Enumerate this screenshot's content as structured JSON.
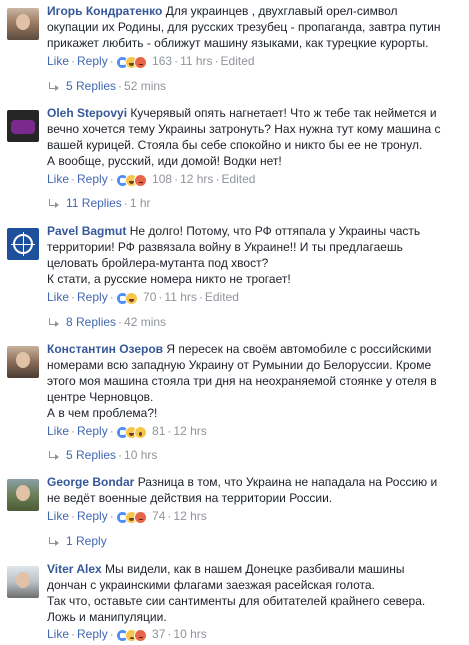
{
  "comments": [
    {
      "author": "Игорь Кондратенко",
      "text": "Для украинцев , двухглавый орел-символ\nокупации их Родины, для русских трезубец - пропаганда, завтра путин\nприкажет любить - оближут машину языками, как турецкие курорты.",
      "like_label": "Like",
      "reply_label": "Reply",
      "reactions": [
        "like",
        "haha",
        "angry"
      ],
      "reaction_count": "163",
      "time": "11 hrs",
      "edited": "Edited",
      "replies": "5 Replies",
      "replies_time": "52 mins"
    },
    {
      "author": "Oleh Stepovyi",
      "text": "Кучерявый опять нагнетает! Что ж тебе так неймется и\nвечно хочется тему Украины затронуть? Нах нужна тут кому машина с\nвашей курицей. Стояла бы себе спокойно и никто бы ее не тронул.\nА вообще, русский, иди домой! Водки нет!",
      "like_label": "Like",
      "reply_label": "Reply",
      "reactions": [
        "like",
        "haha",
        "angry"
      ],
      "reaction_count": "108",
      "time": "12 hrs",
      "edited": "Edited",
      "replies": "11 Replies",
      "replies_time": "1 hr"
    },
    {
      "author": "Pavel Bagmut",
      "text": "Не долго! Потому, что РФ оттяпала у Украины часть\nтерритории! РФ развязала войну в Украине!! И ты предлагаешь\nцеловать бройлера-мутанта под хвост?\nК стати, а русские номера никто не трогает!",
      "like_label": "Like",
      "reply_label": "Reply",
      "reactions": [
        "like",
        "haha"
      ],
      "reaction_count": "70",
      "time": "11 hrs",
      "edited": "Edited",
      "replies": "8 Replies",
      "replies_time": "42 mins"
    },
    {
      "author": "Константин Озеров",
      "text": "Я пересек на своём автомобиле с российскими\nномерами всю западную Украину от Румынии до Белоруссии. Кроме\nэтого моя машина стояла три дня на неохраняемой стоянке у отеля в\nцентре Черновцов.\nА в чем проблема?!",
      "like_label": "Like",
      "reply_label": "Reply",
      "reactions": [
        "like",
        "haha",
        "wow"
      ],
      "reaction_count": "81",
      "time": "12 hrs",
      "edited": "",
      "replies": "5 Replies",
      "replies_time": "10 hrs"
    },
    {
      "author": "George Bondar",
      "text": "Разница в том, что Украина не нападала на Россию и\nне ведёт военные действия на территории России.",
      "like_label": "Like",
      "reply_label": "Reply",
      "reactions": [
        "like",
        "haha",
        "angry"
      ],
      "reaction_count": "74",
      "time": "12 hrs",
      "edited": "",
      "replies": "1 Reply",
      "replies_time": ""
    },
    {
      "author": "Viter Alex",
      "text": "Мы видели, как в нашем Донецке разбивали машины\nдончан с украинскими флагами заезжая расейская голота.\nТак что, оставьте сии сантименты для обитателей крайнего севера.\nЛожь и манипуляции.",
      "like_label": "Like",
      "reply_label": "Reply",
      "reactions": [
        "like",
        "sad",
        "angry"
      ],
      "reaction_count": "37",
      "time": "10 hrs",
      "edited": "",
      "replies": "",
      "replies_time": ""
    }
  ]
}
